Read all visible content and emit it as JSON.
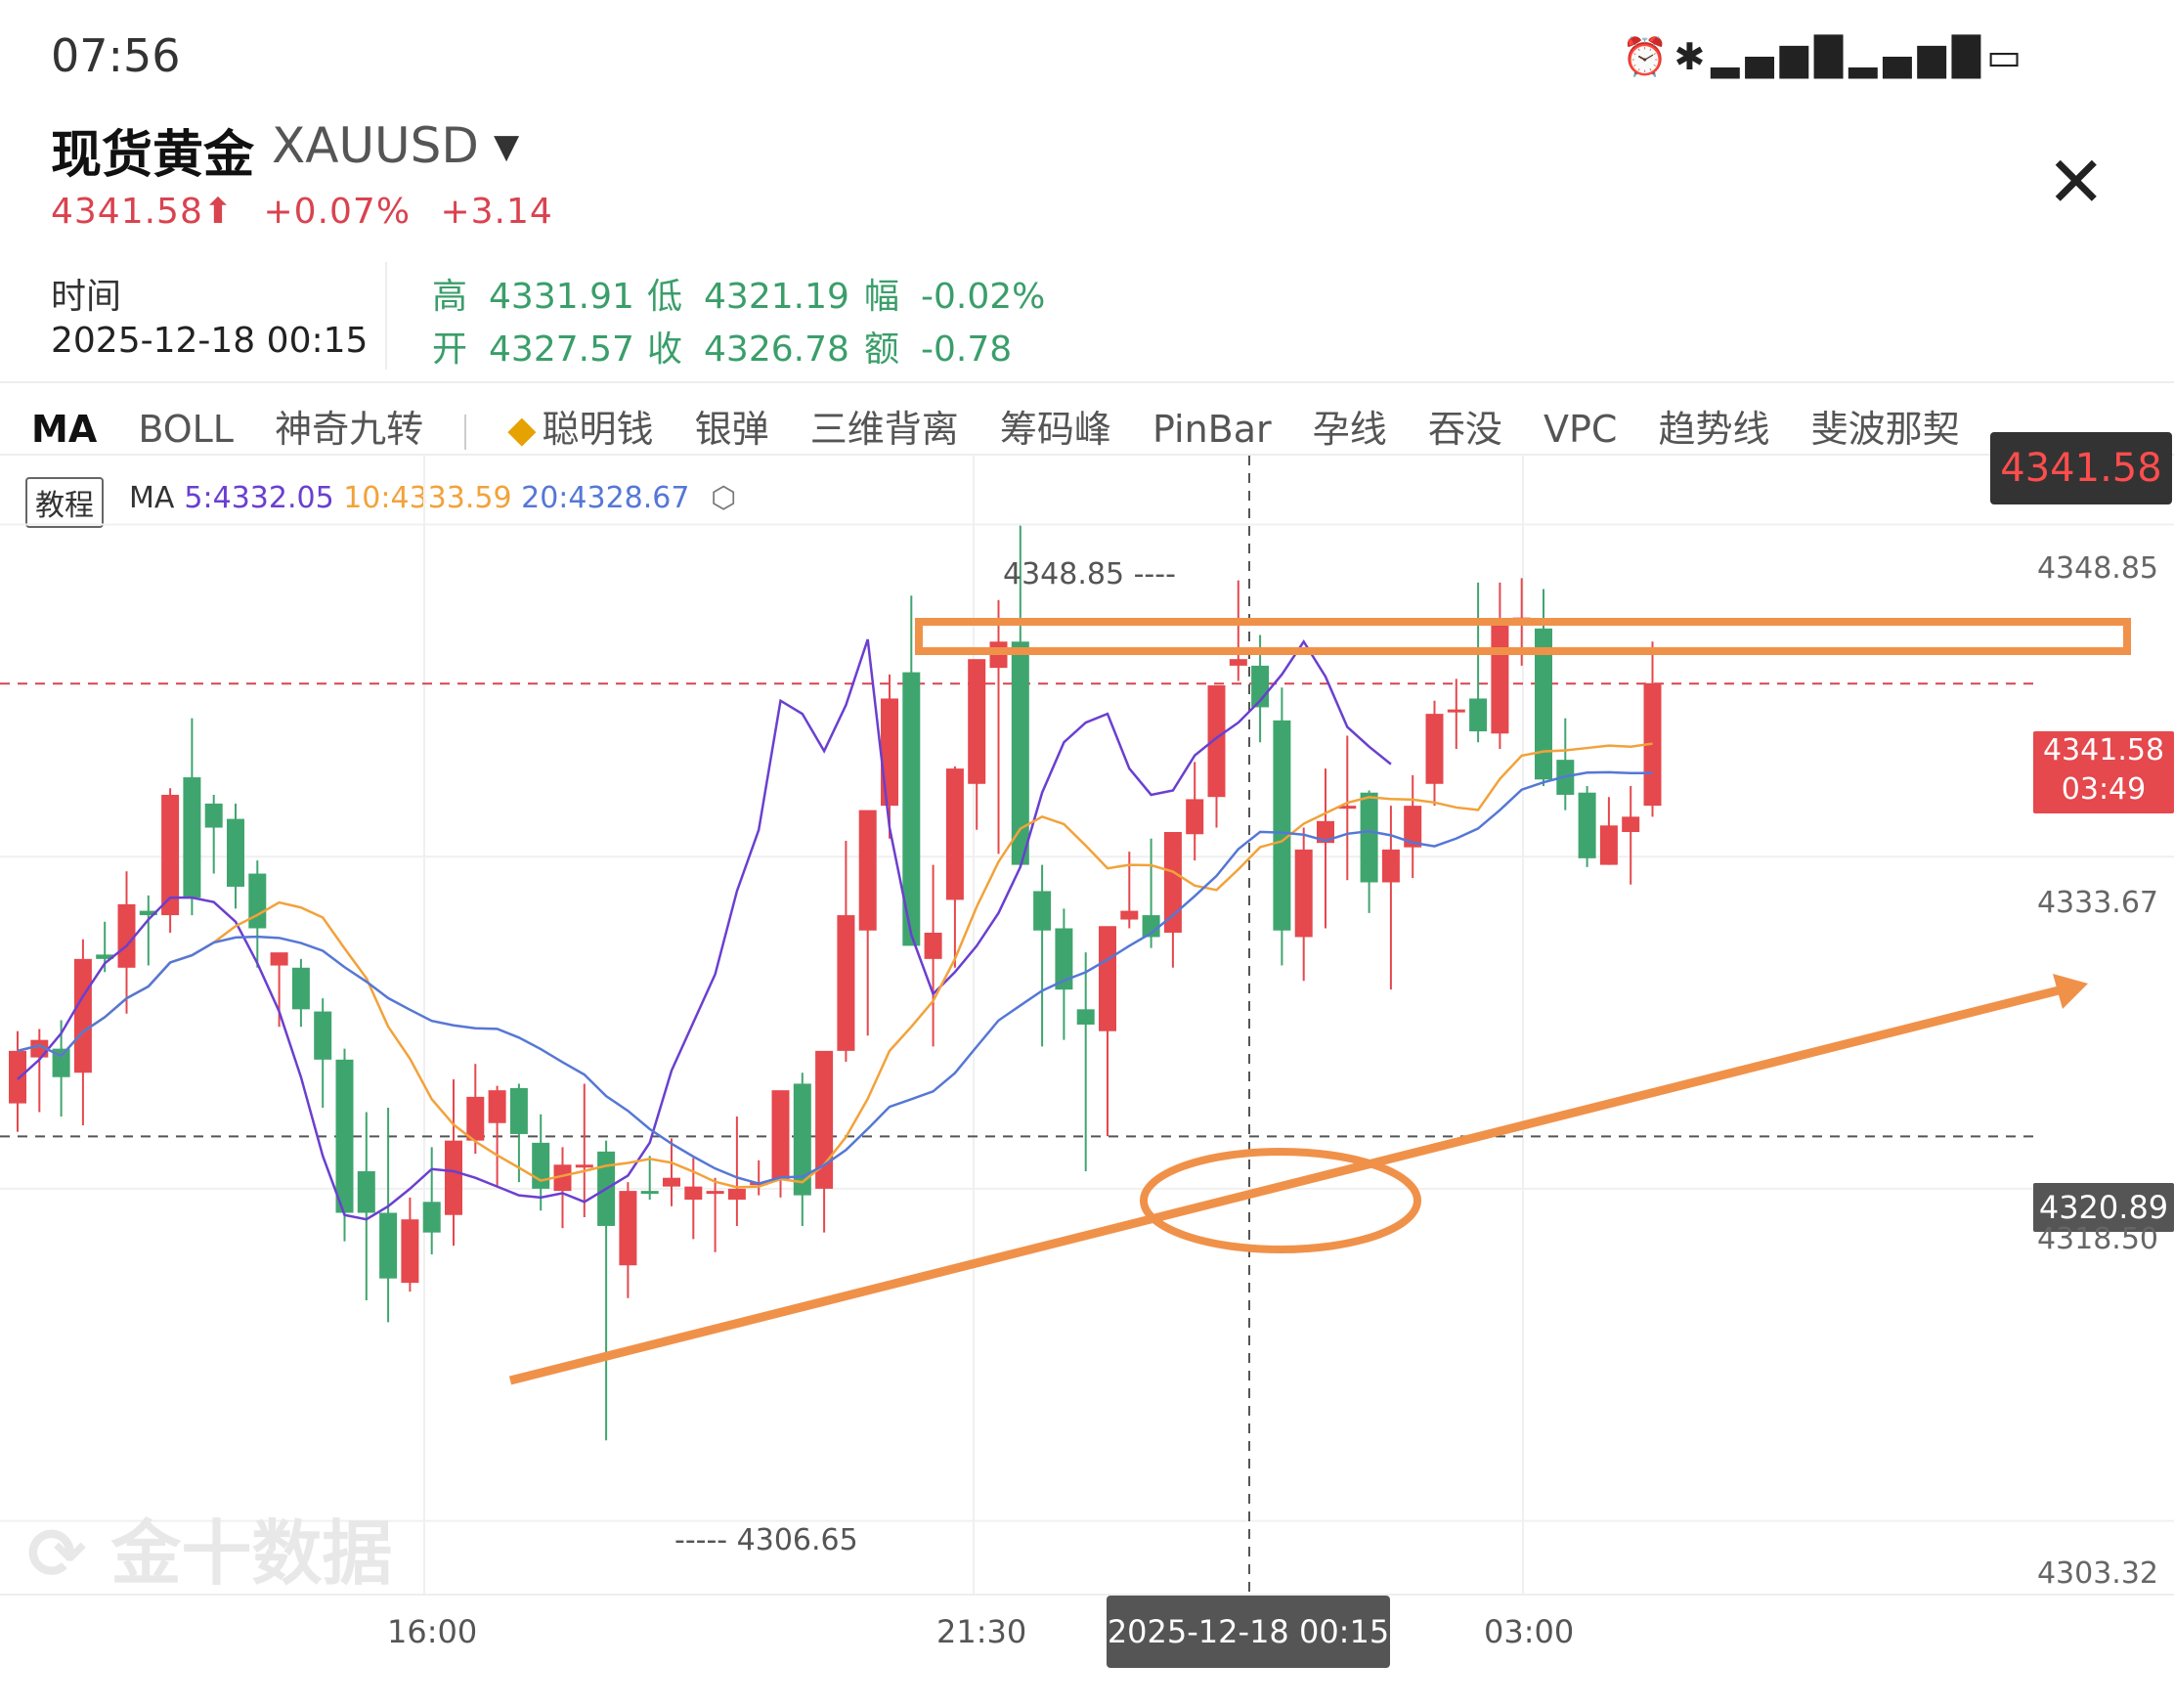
{
  "status_bar": {
    "time": "07:56",
    "icons": [
      "alarm-icon",
      "bluetooth-icon",
      "signal-icon",
      "signal-icon",
      "battery-icon"
    ]
  },
  "header": {
    "title": "现货黄金",
    "symbol": "XAUUSD",
    "price": "4341.58⬆",
    "change_pct": "+0.07%",
    "change_abs": "+3.14"
  },
  "info": {
    "time_label": "时间",
    "time_value": "2025-12-18 00:15",
    "high_label": "高",
    "high": "4331.91",
    "low_label": "低",
    "low": "4321.19",
    "amp_label": "幅",
    "amp": "-0.02%",
    "open_label": "开",
    "open": "4327.57",
    "close_label": "收",
    "close": "4326.78",
    "amt_label": "额",
    "amt": "-0.78"
  },
  "toolbar": {
    "items": [
      "MA",
      "BOLL",
      "神奇九转",
      "聪明钱",
      "银弹",
      "三维背离",
      "筹码峰",
      "PinBar",
      "孕线",
      "吞没",
      "VPC",
      "趋势线",
      "斐波那契"
    ]
  },
  "ma": {
    "tag": "教程",
    "label": "MA",
    "ma5": "5:4332.05",
    "ma10": "10:4333.59",
    "ma20": "20:4328.67"
  },
  "price_tags": {
    "top": "4341.58",
    "current": "4341.58",
    "countdown": "03:49",
    "crosshair": "4320.89"
  },
  "chart_data": {
    "type": "candlestick",
    "y_ticks": [
      "4348.85",
      "4333.67",
      "4318.50",
      "4303.32"
    ],
    "x_ticks": [
      "16:00",
      "21:30",
      "03:00"
    ],
    "crosshair_time": "2025-12-18 00:15",
    "high_marker": "4348.85",
    "low_marker": "4306.65",
    "colors": {
      "up": "#e5484d",
      "down": "#3fa56e",
      "ma5": "#6a3fd0",
      "ma10": "#f2a23a",
      "ma20": "#5577d6",
      "annotation": "#f0914a"
    },
    "ylim": [
      4300.0,
      4352.0
    ],
    "candles": [
      [
        4322.4,
        4325.7,
        4321.1,
        4324.8
      ],
      [
        4324.5,
        4325.8,
        4322.0,
        4325.3
      ],
      [
        4324.9,
        4326.2,
        4321.8,
        4323.6
      ],
      [
        4323.8,
        4329.9,
        4321.4,
        4329.0
      ],
      [
        4329.2,
        4330.7,
        4328.4,
        4329.0
      ],
      [
        4328.6,
        4333.0,
        4326.5,
        4331.5
      ],
      [
        4331.2,
        4331.9,
        4328.7,
        4331.0
      ],
      [
        4331.0,
        4336.8,
        4330.2,
        4336.5
      ],
      [
        4337.3,
        4340.0,
        4331.0,
        4331.8
      ],
      [
        4336.1,
        4336.5,
        4332.9,
        4335.0
      ],
      [
        4335.4,
        4336.1,
        4331.3,
        4332.3
      ],
      [
        4332.9,
        4333.5,
        4328.6,
        4330.4
      ],
      [
        4328.7,
        4329.2,
        4325.9,
        4329.3
      ],
      [
        4328.6,
        4329.0,
        4325.9,
        4326.7
      ],
      [
        4326.6,
        4327.2,
        4322.2,
        4324.4
      ],
      [
        4324.4,
        4324.9,
        4316.1,
        4317.4
      ],
      [
        4319.3,
        4322.0,
        4313.4,
        4317.4
      ],
      [
        4317.4,
        4322.2,
        4312.4,
        4314.4
      ],
      [
        4314.2,
        4318.1,
        4313.8,
        4317.1
      ],
      [
        4317.9,
        4320.4,
        4315.5,
        4316.5
      ],
      [
        4317.3,
        4323.5,
        4315.9,
        4320.7
      ],
      [
        4320.7,
        4324.2,
        4320.1,
        4322.7
      ],
      [
        4321.5,
        4323.2,
        4318.6,
        4323.0
      ],
      [
        4323.1,
        4323.3,
        4318.8,
        4321.0
      ],
      [
        4320.6,
        4321.9,
        4317.5,
        4318.5
      ],
      [
        4318.4,
        4320.4,
        4316.7,
        4319.6
      ],
      [
        4319.6,
        4323.3,
        4317.2,
        4319.6
      ],
      [
        4320.2,
        4320.7,
        4307.0,
        4316.8
      ],
      [
        4315.0,
        4318.8,
        4313.5,
        4318.4
      ],
      [
        4318.4,
        4320.0,
        4318.0,
        4318.3
      ],
      [
        4318.6,
        4320.8,
        4317.7,
        4319.0
      ],
      [
        4318.0,
        4319.9,
        4316.2,
        4318.6
      ],
      [
        4318.3,
        4319.0,
        4315.6,
        4318.4
      ],
      [
        4318.0,
        4321.8,
        4316.8,
        4318.5
      ],
      [
        4318.7,
        4319.8,
        4318.2,
        4318.8
      ],
      [
        4318.9,
        4321.4,
        4318.1,
        4323.0
      ],
      [
        4323.3,
        4323.8,
        4316.8,
        4318.2
      ],
      [
        4318.5,
        4324.6,
        4316.5,
        4324.8
      ],
      [
        4324.8,
        4334.4,
        4324.3,
        4331.0
      ],
      [
        4330.3,
        4335.4,
        4325.5,
        4335.8
      ],
      [
        4336.0,
        4342.0,
        4334.5,
        4340.9
      ],
      [
        4342.1,
        4345.6,
        4332.6,
        4329.6
      ],
      [
        4329.0,
        4333.3,
        4325.0,
        4330.2
      ],
      [
        4331.7,
        4337.8,
        4328.6,
        4337.7
      ],
      [
        4337.0,
        4342.4,
        4334.9,
        4342.7
      ],
      [
        4342.3,
        4345.4,
        4333.8,
        4343.5
      ],
      [
        4343.5,
        4348.8,
        4333.2,
        4333.3
      ],
      [
        4332.1,
        4333.3,
        4325.0,
        4330.3
      ],
      [
        4330.4,
        4331.3,
        4325.3,
        4327.6
      ],
      [
        4326.7,
        4329.3,
        4319.3,
        4326.0
      ],
      [
        4325.7,
        4329.0,
        4320.9,
        4330.5
      ],
      [
        4330.8,
        4333.9,
        4330.4,
        4331.2
      ],
      [
        4331.0,
        4334.5,
        4329.5,
        4330.0
      ],
      [
        4330.2,
        4334.2,
        4328.6,
        4334.8
      ],
      [
        4334.7,
        4338.0,
        4333.5,
        4336.3
      ],
      [
        4336.4,
        4341.4,
        4335.0,
        4341.5
      ],
      [
        4342.4,
        4346.3,
        4341.7,
        4342.7
      ],
      [
        4342.4,
        4343.8,
        4338.9,
        4340.5
      ],
      [
        4339.9,
        4341.4,
        4328.7,
        4330.3
      ],
      [
        4330.0,
        4335.0,
        4328.0,
        4334.0
      ],
      [
        4334.3,
        4337.7,
        4330.4,
        4335.3
      ],
      [
        4335.9,
        4339.2,
        4332.6,
        4336.0
      ],
      [
        4336.6,
        4336.7,
        4331.1,
        4332.5
      ],
      [
        4332.5,
        4336.0,
        4327.6,
        4334.0
      ],
      [
        4334.1,
        4337.4,
        4332.7,
        4336.0
      ],
      [
        4337.0,
        4340.8,
        4336.0,
        4340.2
      ],
      [
        4340.3,
        4341.8,
        4338.6,
        4340.4
      ],
      [
        4340.9,
        4346.2,
        4338.9,
        4339.4
      ],
      [
        4339.3,
        4346.2,
        4338.6,
        4344.5
      ],
      [
        4344.4,
        4346.4,
        4342.4,
        4344.6
      ],
      [
        4344.1,
        4345.9,
        4336.9,
        4337.2
      ],
      [
        4338.1,
        4340.0,
        4335.8,
        4336.5
      ],
      [
        4336.6,
        4336.9,
        4333.2,
        4333.6
      ],
      [
        4333.3,
        4336.4,
        4333.3,
        4335.1
      ],
      [
        4334.8,
        4336.9,
        4332.4,
        4335.5
      ],
      [
        4336.0,
        4343.5,
        4335.5,
        4341.6
      ]
    ],
    "ma5": [
      4323.5,
      4324.4,
      4325.6,
      4327.3,
      4328.8,
      4329.6,
      4330.8,
      4331.8,
      4331.8,
      4331.6,
      4330.7,
      4328.8,
      4326.6,
      4323.6,
      4320.0,
      4317.3,
      4317.1,
      4317.7,
      4318.5,
      4319.4,
      4319.3,
      4319.0,
      4318.6,
      4318.2,
      4318.1,
      4318.3,
      4317.9,
      4318.5,
      4319.1,
      4320.6,
      4323.9,
      4326.1,
      4328.3,
      4332.1,
      4334.9,
      4340.8,
      4340.2,
      4338.5,
      4340.6,
      4343.6,
      4335.0,
      4330.1,
      4327.4,
      4328.4,
      4329.6,
      4331.1,
      4333.2,
      4336.6,
      4338.9,
      4339.8,
      4340.2,
      4337.7,
      4336.5,
      4336.7,
      4338.3,
      4339.1,
      4339.8,
      4340.8,
      4342.0,
      4343.5,
      4341.9,
      4339.6,
      4338.7,
      4337.9
    ]
  }
}
